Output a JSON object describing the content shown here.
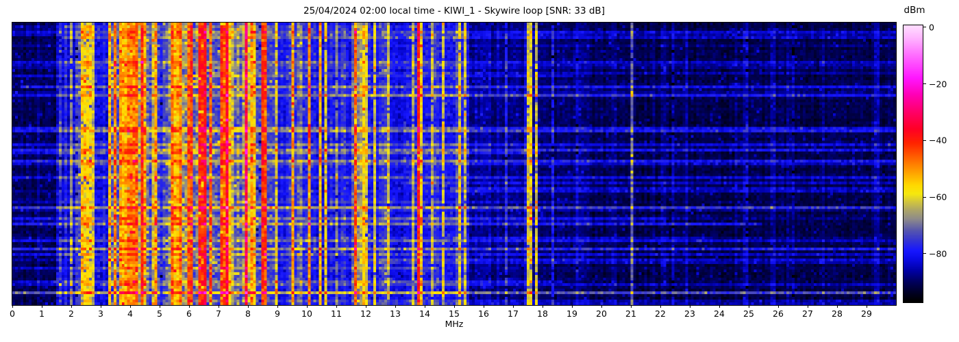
{
  "title": "25/04/2024 02:00 local time - KIWI_1 - Skywire loop [SNR: 33 dB]",
  "xlabel": "MHz",
  "colorbar_unit": "dBm",
  "chart_data": {
    "type": "heatmap",
    "subtype": "hf-spectrogram-waterfall",
    "title": "25/04/2024 02:00 local time - KIWI_1 - Skywire loop [SNR: 33 dB]",
    "xlabel": "MHz",
    "ylabel": "",
    "value_unit": "dBm",
    "x_range_mhz": [
      0,
      30
    ],
    "x_ticks_mhz": [
      0,
      1,
      2,
      3,
      4,
      5,
      6,
      7,
      8,
      9,
      10,
      11,
      12,
      13,
      14,
      15,
      16,
      17,
      18,
      19,
      20,
      21,
      22,
      23,
      24,
      25,
      26,
      27,
      28,
      29
    ],
    "value_range_dbm": [
      -97,
      0
    ],
    "colorbar_ticks": [
      {
        "v": 0,
        "label": "0"
      },
      {
        "v": -20,
        "label": "−20"
      },
      {
        "v": -40,
        "label": "−40"
      },
      {
        "v": -60,
        "label": "−60"
      },
      {
        "v": -80,
        "label": "−80"
      }
    ],
    "colorbar_top_value": 0.6,
    "colorbar_bottom_value": -97.3,
    "colormap_stops": [
      [
        -97,
        "#000000"
      ],
      [
        -94,
        "#000024"
      ],
      [
        -90,
        "#00005e"
      ],
      [
        -86,
        "#0000a8"
      ],
      [
        -82,
        "#0b0be6"
      ],
      [
        -79,
        "#1818ff"
      ],
      [
        -76,
        "#3030d8"
      ],
      [
        -72,
        "#5656ae"
      ],
      [
        -68,
        "#8d8a8b"
      ],
      [
        -65,
        "#aaa36b"
      ],
      [
        -62,
        "#cfc341"
      ],
      [
        -59,
        "#f6e80e"
      ],
      [
        -56,
        "#ffd900"
      ],
      [
        -51,
        "#ff9d00"
      ],
      [
        -46,
        "#ff6000"
      ],
      [
        -41,
        "#ff2300"
      ],
      [
        -36,
        "#ff0026"
      ],
      [
        -30,
        "#ff0068"
      ],
      [
        -24,
        "#ff00b4"
      ],
      [
        -18,
        "#ff16ff"
      ],
      [
        -10,
        "#ff6cff"
      ],
      [
        -4,
        "#ffb3ff"
      ],
      [
        0,
        "#ffd9ff"
      ]
    ],
    "grid_cols": 323,
    "grid_rows": 103,
    "bands": [
      {
        "from": 0.0,
        "to": 1.5,
        "base": -90.8,
        "noise": 3.2,
        "stripe_density": 0.06,
        "stripe_max": 5
      },
      {
        "from": 1.5,
        "to": 2.25,
        "base": -84.0,
        "noise": 4.0,
        "stripe_density": 0.5,
        "stripe_max": 9
      },
      {
        "from": 2.25,
        "to": 2.8,
        "base": -76.0,
        "noise": 6.0,
        "stripe_density": 0.6,
        "stripe_max": 20
      },
      {
        "from": 2.8,
        "to": 3.3,
        "base": -82.0,
        "noise": 5.0,
        "stripe_density": 0.4,
        "stripe_max": 9
      },
      {
        "from": 3.3,
        "to": 8.6,
        "base": -74.0,
        "noise": 7.0,
        "stripe_density": 0.62,
        "stripe_max": 30
      },
      {
        "from": 8.6,
        "to": 9.3,
        "base": -81.0,
        "noise": 4.0,
        "stripe_density": 0.3,
        "stripe_max": 7
      },
      {
        "from": 9.3,
        "to": 10.15,
        "base": -79.0,
        "noise": 5.0,
        "stripe_density": 0.5,
        "stripe_max": 18
      },
      {
        "from": 10.15,
        "to": 11.55,
        "base": -82.0,
        "noise": 4.5,
        "stripe_density": 0.35,
        "stripe_max": 10
      },
      {
        "from": 11.55,
        "to": 12.2,
        "base": -79.0,
        "noise": 5.0,
        "stripe_density": 0.5,
        "stripe_max": 16
      },
      {
        "from": 12.2,
        "to": 13.55,
        "base": -82.0,
        "noise": 4.5,
        "stripe_density": 0.35,
        "stripe_max": 9
      },
      {
        "from": 13.55,
        "to": 13.95,
        "base": -78.0,
        "noise": 5.0,
        "stripe_density": 0.5,
        "stripe_max": 14
      },
      {
        "from": 13.95,
        "to": 15.05,
        "base": -81.0,
        "noise": 4.5,
        "stripe_density": 0.4,
        "stripe_max": 9
      },
      {
        "from": 15.05,
        "to": 15.5,
        "base": -82.0,
        "noise": 4.0,
        "stripe_density": 0.4,
        "stripe_max": 12
      },
      {
        "from": 15.5,
        "to": 16.3,
        "base": -87.0,
        "noise": 3.5,
        "stripe_density": 0.2,
        "stripe_max": 6
      },
      {
        "from": 16.3,
        "to": 18.4,
        "base": -88.5,
        "noise": 3.0,
        "stripe_density": 0.25,
        "stripe_max": 6
      },
      {
        "from": 18.4,
        "to": 19.6,
        "base": -90.0,
        "noise": 3.0,
        "stripe_density": 0.2,
        "stripe_max": 6
      },
      {
        "from": 19.6,
        "to": 30.0,
        "base": -91.5,
        "noise": 3.0,
        "stripe_density": 0.12,
        "stripe_max": 5
      }
    ],
    "carriers": [
      {
        "f": 1.62,
        "level": -76,
        "w": 0.06
      },
      {
        "f": 1.98,
        "level": -69,
        "w": 0.05
      },
      {
        "f": 2.18,
        "level": -75,
        "w": 0.05
      },
      {
        "f": 2.45,
        "level": -57,
        "w": 0.22
      },
      {
        "f": 2.65,
        "level": -59,
        "w": 0.1
      },
      {
        "f": 3.33,
        "level": -55,
        "w": 0.08
      },
      {
        "f": 3.52,
        "level": -50,
        "w": 0.08
      },
      {
        "f": 3.65,
        "level": -52,
        "w": 0.06
      },
      {
        "f": 3.95,
        "level": -49,
        "w": 0.1
      },
      {
        "f": 4.19,
        "level": -47,
        "w": 0.08
      },
      {
        "f": 4.47,
        "level": -54,
        "w": 0.08
      },
      {
        "f": 4.85,
        "level": -52,
        "w": 0.08
      },
      {
        "f": 5.06,
        "level": -79,
        "w": 0.12
      },
      {
        "f": 5.45,
        "level": -48,
        "w": 0.08
      },
      {
        "f": 5.75,
        "level": -50,
        "w": 0.06
      },
      {
        "f": 6.09,
        "level": -44,
        "w": 0.07
      },
      {
        "f": 6.4,
        "level": -42,
        "w": 0.2
      },
      {
        "f": 6.75,
        "level": -47,
        "w": 0.07
      },
      {
        "f": 7.1,
        "level": -43,
        "w": 0.08
      },
      {
        "f": 7.3,
        "level": -36,
        "w": 0.07
      },
      {
        "f": 7.62,
        "level": -46,
        "w": 0.07
      },
      {
        "f": 7.95,
        "level": -33,
        "w": 0.09
      },
      {
        "f": 8.1,
        "level": -52,
        "w": 0.06
      },
      {
        "f": 8.35,
        "level": -75,
        "w": 0.15
      },
      {
        "f": 8.95,
        "level": -62,
        "w": 0.05
      },
      {
        "f": 9.5,
        "level": -52,
        "w": 0.07
      },
      {
        "f": 9.75,
        "level": -58,
        "w": 0.06
      },
      {
        "f": 10.08,
        "level": -51,
        "w": 0.08
      },
      {
        "f": 10.45,
        "level": -55,
        "w": 0.07
      },
      {
        "f": 10.6,
        "level": -60,
        "w": 0.05
      },
      {
        "f": 11.0,
        "level": -70,
        "w": 0.05
      },
      {
        "f": 11.65,
        "level": -47,
        "w": 0.08
      },
      {
        "f": 11.9,
        "level": -58,
        "w": 0.07
      },
      {
        "f": 12.05,
        "level": -62,
        "w": 0.06
      },
      {
        "f": 12.3,
        "level": -63,
        "w": 0.05
      },
      {
        "f": 12.8,
        "level": -64,
        "w": 0.05
      },
      {
        "f": 13.28,
        "level": -63,
        "w": 0.05
      },
      {
        "f": 13.6,
        "level": -66,
        "w": 0.06
      },
      {
        "f": 13.76,
        "level": -41,
        "w": 0.08
      },
      {
        "f": 13.88,
        "level": -58,
        "w": 0.05
      },
      {
        "f": 14.22,
        "level": -66,
        "w": 0.05
      },
      {
        "f": 14.6,
        "level": -63,
        "w": 0.06
      },
      {
        "f": 15.2,
        "level": -61,
        "w": 0.05
      },
      {
        "f": 15.38,
        "level": -64,
        "w": 0.05
      },
      {
        "f": 16.8,
        "level": -79,
        "w": 0.05
      },
      {
        "f": 17.5,
        "level": -62,
        "w": 0.06
      },
      {
        "f": 17.62,
        "level": -60,
        "w": 0.06
      },
      {
        "f": 17.76,
        "level": -63,
        "w": 0.05
      },
      {
        "f": 18.35,
        "level": -81,
        "w": 0.1
      },
      {
        "f": 19.2,
        "level": -84,
        "w": 0.05
      },
      {
        "f": 21.05,
        "level": -72,
        "w": 0.04
      },
      {
        "f": 22.4,
        "level": -86,
        "w": 0.04
      },
      {
        "f": 24.9,
        "level": -85,
        "w": 0.04
      },
      {
        "f": 26.5,
        "level": -88,
        "w": 0.04
      }
    ],
    "streaks": {
      "count": 48,
      "strong_count": 8,
      "weak_boost_db": [
        2,
        8
      ],
      "strong_boost_db": [
        8,
        13
      ]
    },
    "grid": false,
    "legend": false
  }
}
